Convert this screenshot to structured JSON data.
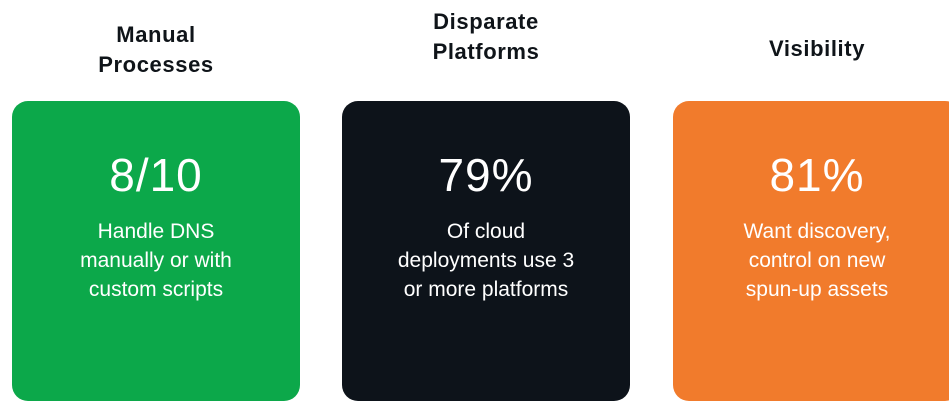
{
  "columns": [
    {
      "heading": "Manual\nProcesses",
      "stat": "8/10",
      "description": "Handle DNS\nmanually or with\ncustom scripts",
      "color": "#0ca84a"
    },
    {
      "heading": "Disparate\nPlatforms",
      "stat": "79%",
      "description": "Of cloud\ndeployments use 3\nor more platforms",
      "color": "#0d131a"
    },
    {
      "heading": "Visibility",
      "stat": "81%",
      "description": "Want discovery,\ncontrol on new\nspun-up assets",
      "color": "#f17b2c"
    }
  ]
}
